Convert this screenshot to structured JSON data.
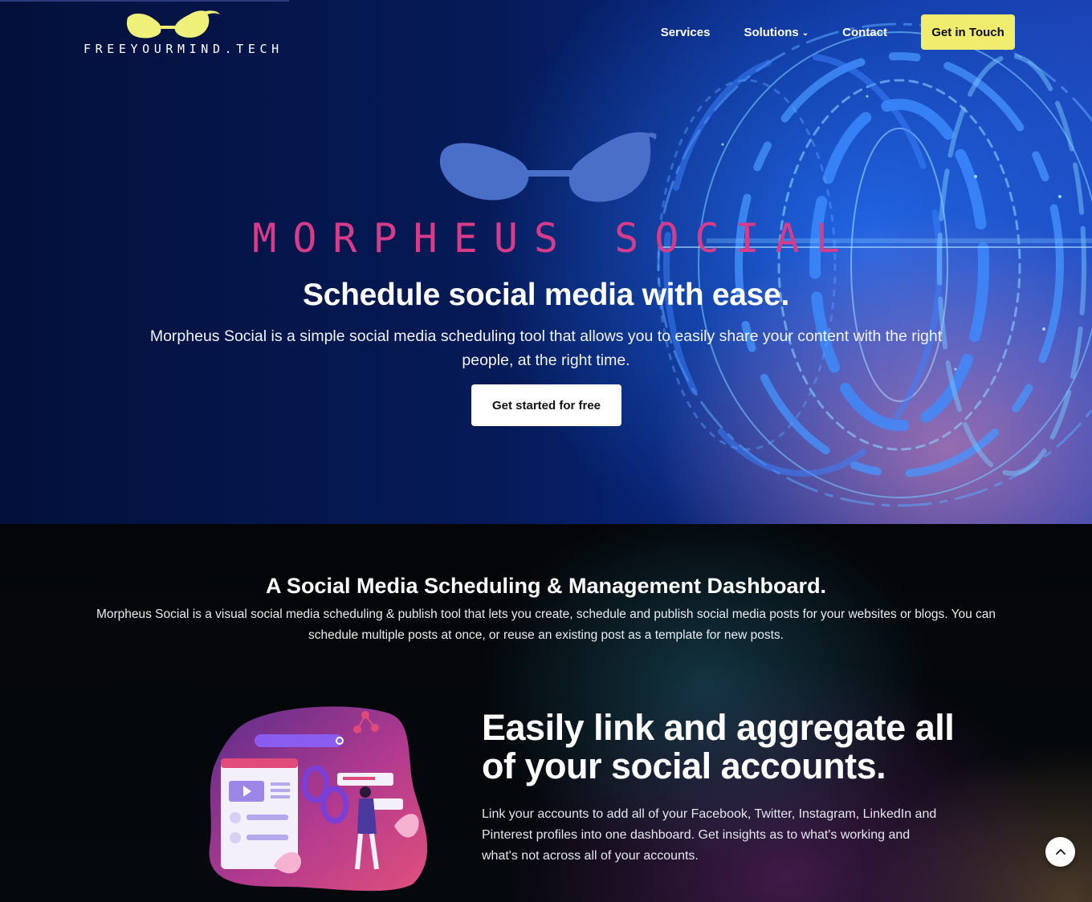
{
  "nav": {
    "logo_text": "FREEYOURMIND.TECH",
    "items": [
      {
        "label": "Services"
      },
      {
        "label": "Solutions"
      },
      {
        "label": "Contact"
      }
    ],
    "cta_label": "Get in Touch"
  },
  "hero": {
    "product_name": "MORPHEUS SOCIAL",
    "title": "Schedule social media with ease.",
    "description": "Morpheus Social is a simple social media scheduling tool that allows you to easily share your content with the right people, at the right time.",
    "button_label": "Get started for free"
  },
  "dashboard_section": {
    "title": "A Social Media Scheduling & Management Dashboard.",
    "description": "Morpheus Social is a visual social media scheduling & publish tool that lets you create, schedule and publish social media posts for your websites or blogs. You can schedule multiple posts at once, or reuse an existing post as a template for new posts."
  },
  "feature": {
    "title": "Easily link and aggregate all of your social accounts.",
    "description": "Link your accounts to add all of your Facebook, Twitter, Instagram, LinkedIn and Pinterest profiles into one dashboard. Get insights as to what's working and what's not across all of your accounts."
  },
  "icons": {
    "logo": "glasses-logo-icon",
    "solutions_dropdown": "chevron-down-icon",
    "scroll_top": "chevron-up-icon"
  },
  "colors": {
    "accent_yellow": "#f0ec6e",
    "product_pink": "#d63c8a",
    "hero_logo_blue": "#4a6fc8"
  }
}
